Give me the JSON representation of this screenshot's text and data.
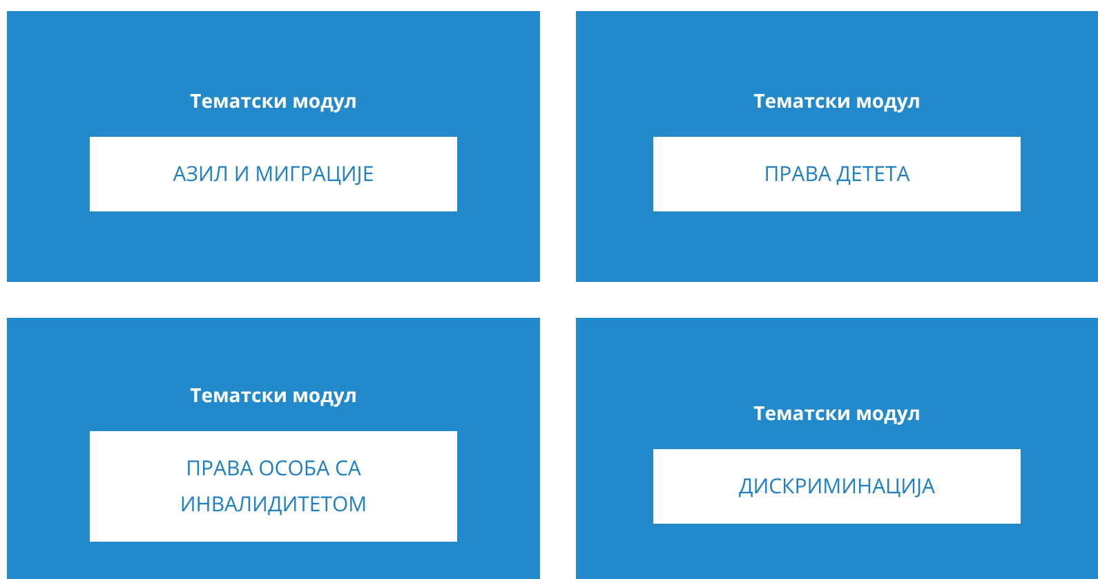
{
  "modules": [
    {
      "label": "Тематски модул",
      "title": "АЗИЛ И МИГРАЦИЈЕ"
    },
    {
      "label": "Тематски модул",
      "title": "ПРАВА ДЕТЕТА"
    },
    {
      "label": "Тематски модул",
      "title": "ПРАВА ОСОБА СА ИНВАЛИДИТЕТОМ"
    },
    {
      "label": "Тематски модул",
      "title": "ДИСКРИМИНАЦИЈА"
    }
  ]
}
